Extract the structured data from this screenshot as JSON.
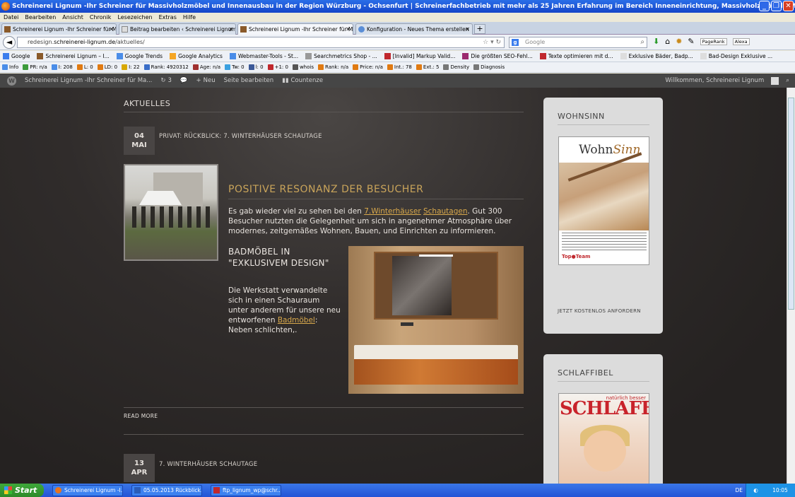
{
  "window": {
    "title": "Schreinerei Lignum -Ihr Schreiner für Massivholzmöbel und Innenausbau in der Region Würzburg - Ochsenfurt | Schreinerfachbetrieb mit mehr als 25 Jahren Erfahrung im Bereich Inneneinrichtung, Massivholzmöbel - Mozilla Firefox",
    "minimize": "_",
    "maximize": "❐",
    "close": "✕"
  },
  "menu": [
    "Datei",
    "Bearbeiten",
    "Ansicht",
    "Chronik",
    "Lesezeichen",
    "Extras",
    "Hilfe"
  ],
  "tabs": [
    {
      "label": "Schreinerei Lignum -Ihr Schreiner für Mas...",
      "close": "✕"
    },
    {
      "label": "Beitrag bearbeiten ‹ Schreinerei Lignum -...",
      "close": "✕"
    },
    {
      "label": "Schreinerei Lignum -Ihr Schreiner für Mas...",
      "close": "✕"
    },
    {
      "label": "Konfiguration - Neues Thema erstellen",
      "close": "✕"
    }
  ],
  "new_tab": "+",
  "nav": {
    "back": "◄",
    "url_prefix": "redesign.",
    "url_host": "schreinerei-lignum.de",
    "url_path": "/aktuelles/",
    "url_icons": "☆ ▾ ↻",
    "search_engine": "g",
    "search_placeholder": "Google",
    "search_icon": "⌕",
    "tools": [
      "⬇",
      "⌂",
      "✹",
      "✎"
    ],
    "pagerank": "PageRank",
    "alexa": "Alexa"
  },
  "bookmarks": [
    {
      "label": "Google",
      "color": "#3b7ded"
    },
    {
      "label": "Schreinerei Lignum – I...",
      "color": "#8a5a2a"
    },
    {
      "label": "Google Trends",
      "color": "#4a8de8"
    },
    {
      "label": "Google Analytics",
      "color": "#f5a623"
    },
    {
      "label": "Webmaster-Tools - St...",
      "color": "#4a8de8"
    },
    {
      "label": "Searchmetrics Shop - ...",
      "color": "#999999"
    },
    {
      "label": "[Invalid] Markup Valid...",
      "color": "#c0282d"
    },
    {
      "label": "Die größten SEO-Fehl...",
      "color": "#9b2a6e"
    },
    {
      "label": "Texte optimieren mit d...",
      "color": "#c0282d"
    },
    {
      "label": "Exklusive Bäder, Badp...",
      "color": "#dddddd"
    },
    {
      "label": "Bad-Design Exklusive ...",
      "color": "#dddddd"
    }
  ],
  "seobar": [
    {
      "label": "Info",
      "color": "#4a8de8"
    },
    {
      "label": "PR: n/a",
      "color": "#3c9b3c"
    },
    {
      "label": "I: 208",
      "color": "#4a8de8"
    },
    {
      "label": "L: 0",
      "color": "#e07a12"
    },
    {
      "label": "LD: 0",
      "color": "#e07a12"
    },
    {
      "label": "I: 22",
      "color": "#d8a800"
    },
    {
      "label": "Rank: 4920312",
      "color": "#3a6ec8"
    },
    {
      "label": "Age: n/a",
      "color": "#a03030"
    },
    {
      "label": "Tw: 0",
      "color": "#3aa0e0"
    },
    {
      "label": "l: 0",
      "color": "#3b5998"
    },
    {
      "label": "+1: 0",
      "color": "#c0282d"
    },
    {
      "label": "whois",
      "color": "#555555"
    },
    {
      "label": "Rank: n/a",
      "color": "#e07a12"
    },
    {
      "label": "Price: n/a",
      "color": "#e07a12"
    },
    {
      "label": "Int.: 78",
      "color": "#e07a12"
    },
    {
      "label": "Ext.: 5",
      "color": "#e07a12"
    },
    {
      "label": "Density",
      "color": "#777777"
    },
    {
      "label": "Diagnosis",
      "color": "#777777"
    }
  ],
  "adminbar": {
    "logo": "W",
    "site": "Schreinerei Lignum -Ihr Schreiner für Ma...",
    "updates": "3",
    "comments_icon": "💬",
    "new": "Neu",
    "edit": "Seite bearbeiten",
    "counter": "Countenze",
    "welcome": "Willkommen, Schreinerei Lignum",
    "search_icon": "⌕"
  },
  "main": {
    "section_title": "AKTUELLES",
    "post1": {
      "day": "04",
      "month": "MAI",
      "heading": "PRIVAT: RÜCKBLICK: 7. WINTERHÄUSER SCHAUTAGE",
      "title": "POSITIVE RESONANZ DER BESUCHER",
      "body_pre": "Es gab wieder viel zu sehen bei den ",
      "link1": "7.Winterhäuser",
      "link2": "Schautagen",
      "body_post": ". Gut 300 Besucher nutzten die Gelegenheit um sich in angenehmer Atmosphäre über modernes, zeitgemäßes Wohnen, Bauen, und Einrichten zu informieren.",
      "subtitle": "BADMÖBEL IN \"EXKLUSIVEM DESIGN\"",
      "sub_pre": "Die Werkstatt verwandelte sich in einen Schauraum unter anderem für unsere neu entworfenen ",
      "sub_link": "Badmöbel",
      "sub_post": ": Neben schlichten,.",
      "readmore": "READ MORE"
    },
    "post2": {
      "day": "13",
      "month": "APR",
      "heading": "7. WINTERHÄUSER SCHAUTAGE"
    }
  },
  "sidebar": {
    "box1": {
      "title": "WOHNSINN",
      "mag_logo": "Wohn",
      "mag_logo2": "Sinn",
      "mag_brand": "Top●Team",
      "link": "JETZT KOSTENLOS ANFORDERN"
    },
    "box2": {
      "title": "SCHLAFFIBEL",
      "mag_small": "natürlich besser",
      "mag_title": "SCHLAFEN"
    }
  },
  "taskbar": {
    "start": "Start",
    "tasks": [
      {
        "label": "Schreinerei Lignum -I...",
        "color": "#e8731f"
      },
      {
        "label": "05.05.2013 Rückblick...",
        "color": "#2b5cb8"
      },
      {
        "label": "ftp_lignum_wp@schr...",
        "color": "#c0282d"
      }
    ],
    "lang": "DE",
    "time": "10:05"
  }
}
